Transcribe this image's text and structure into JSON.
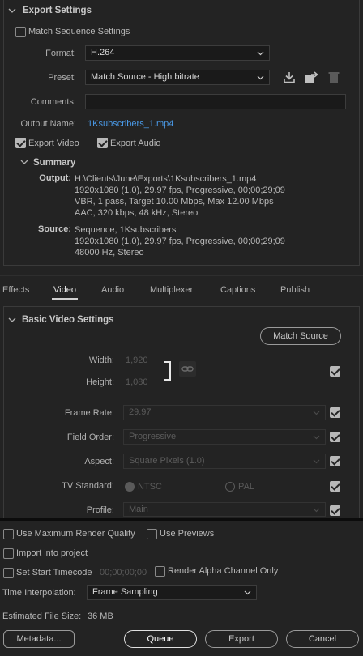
{
  "export_settings": {
    "title": "Export Settings",
    "match_sequence_label": "Match Sequence Settings",
    "format_label": "Format:",
    "format_value": "H.264",
    "preset_label": "Preset:",
    "preset_value": "Match Source - High bitrate",
    "comments_label": "Comments:",
    "comments_value": "",
    "output_name_label": "Output Name:",
    "output_name_value": "1Ksubscribers_1.mp4",
    "export_video_label": "Export Video",
    "export_audio_label": "Export Audio",
    "export_video_checked": true,
    "export_audio_checked": true,
    "summary": {
      "title": "Summary",
      "output_label": "Output:",
      "output_lines": [
        "H:\\Clients\\June\\Exports\\1Ksubscribers_1.mp4",
        "1920x1080 (1.0), 29.97 fps, Progressive, 00;00;29;09",
        "VBR, 1 pass, Target 10.00 Mbps, Max 12.00 Mbps",
        "AAC, 320 kbps, 48 kHz, Stereo"
      ],
      "source_label": "Source:",
      "source_lines": [
        "Sequence, 1Ksubscribers",
        "1920x1080 (1.0), 29.97 fps, Progressive, 00;00;29;09",
        "48000 Hz, Stereo"
      ]
    }
  },
  "tabs": [
    "Effects",
    "Video",
    "Audio",
    "Multiplexer",
    "Captions",
    "Publish"
  ],
  "active_tab": "Video",
  "video": {
    "section_title": "Basic Video Settings",
    "match_source_button": "Match Source",
    "width_label": "Width:",
    "width_value": "1,920",
    "height_label": "Height:",
    "height_value": "1,080",
    "frame_rate_label": "Frame Rate:",
    "frame_rate_value": "29.97",
    "field_order_label": "Field Order:",
    "field_order_value": "Progressive",
    "aspect_label": "Aspect:",
    "aspect_value": "Square Pixels (1.0)",
    "tv_standard_label": "TV Standard:",
    "tv_ntsc": "NTSC",
    "tv_pal": "PAL",
    "profile_label": "Profile:",
    "profile_value": "Main"
  },
  "bottom": {
    "max_render_label": "Use Maximum Render Quality",
    "use_previews_label": "Use Previews",
    "import_project_label": "Import into project",
    "set_start_tc_label": "Set Start Timecode",
    "start_tc_value": "00;00;00;00",
    "render_alpha_label": "Render Alpha Channel Only",
    "time_interp_label": "Time Interpolation:",
    "time_interp_value": "Frame Sampling",
    "est_size_label": "Estimated File Size:",
    "est_size_value": "36 MB",
    "metadata_button": "Metadata...",
    "queue_button": "Queue",
    "export_button": "Export",
    "cancel_button": "Cancel"
  },
  "colors": {
    "accent_link": "#4a9ae8",
    "background": "#232323"
  }
}
